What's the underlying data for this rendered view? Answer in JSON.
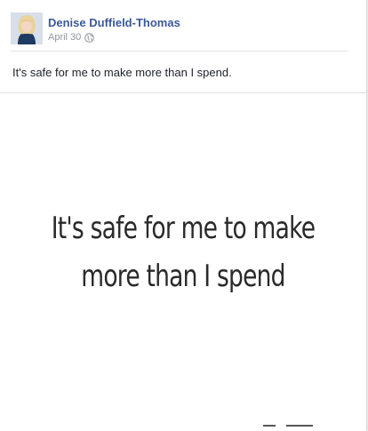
{
  "post": {
    "author": "Denise Duffield-Thomas",
    "date": "April 30",
    "privacy_icon": "globe-icon",
    "text": "It's safe for me to make more than I spend."
  },
  "image": {
    "line1": "It's safe for me to make",
    "line2": "more than I spend"
  },
  "colors": {
    "author_link": "#3b5998",
    "meta_text": "#90949c",
    "body_text": "#1d2129"
  }
}
